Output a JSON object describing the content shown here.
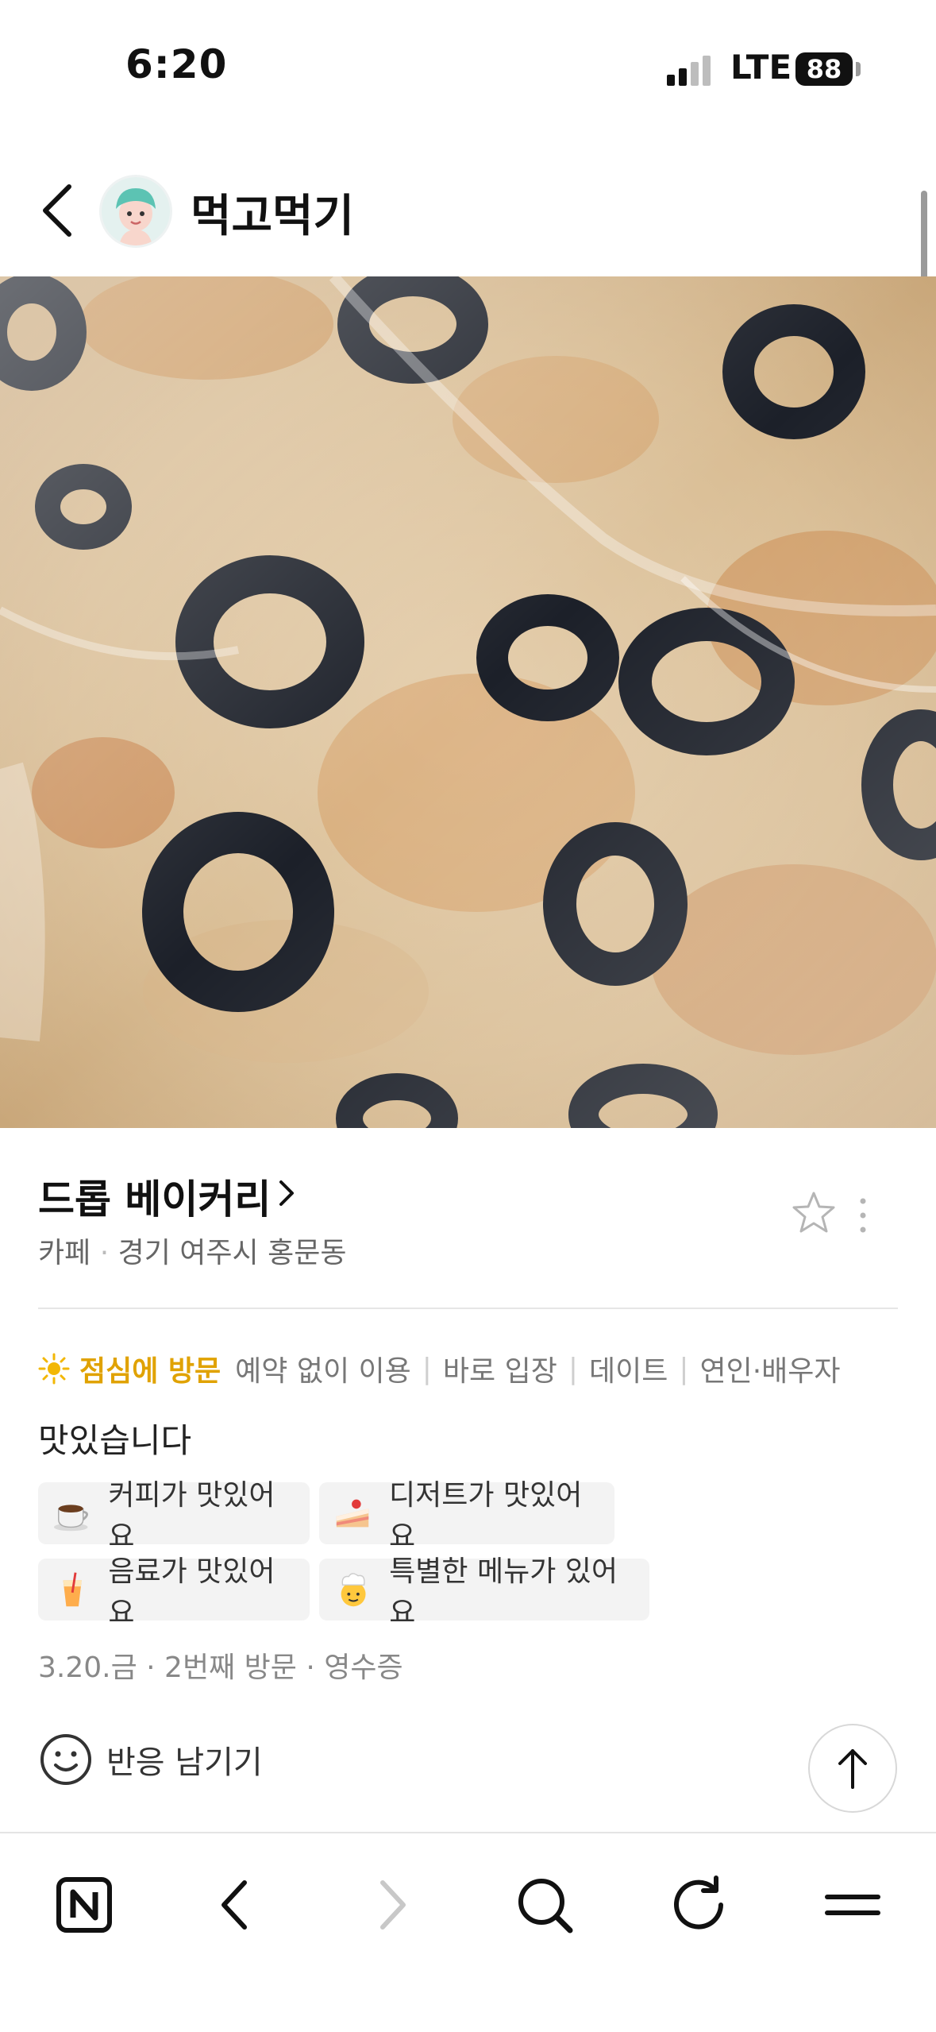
{
  "status_bar": {
    "time": "6:20",
    "network": "LTE",
    "battery": "88"
  },
  "header": {
    "title": "먹고먹기"
  },
  "place": {
    "name": "드롭 베이커리",
    "category": "카페",
    "location": "경기 여주시 홍문동"
  },
  "visit_tags": {
    "lead": "점심에 방문",
    "items": [
      "예약 없이 이용",
      "바로 입장",
      "데이트",
      "연인·배우자"
    ]
  },
  "review_text": "맛있습니다",
  "keywords": [
    {
      "icon": "coffee-icon",
      "label": "커피가 맛있어요"
    },
    {
      "icon": "cake-icon",
      "label": "디저트가 맛있어요"
    },
    {
      "icon": "drink-icon",
      "label": "음료가 맛있어요"
    },
    {
      "icon": "chef-icon",
      "label": "특별한 메뉴가 있어요"
    }
  ],
  "visit_info": "3.20.금 · 2번째 방문 · 영수증",
  "reaction": {
    "label": "반응 남기기"
  },
  "colors": {
    "accent": "#e0a200",
    "text_secondary": "#666666",
    "chip_bg": "#f3f3f3"
  }
}
